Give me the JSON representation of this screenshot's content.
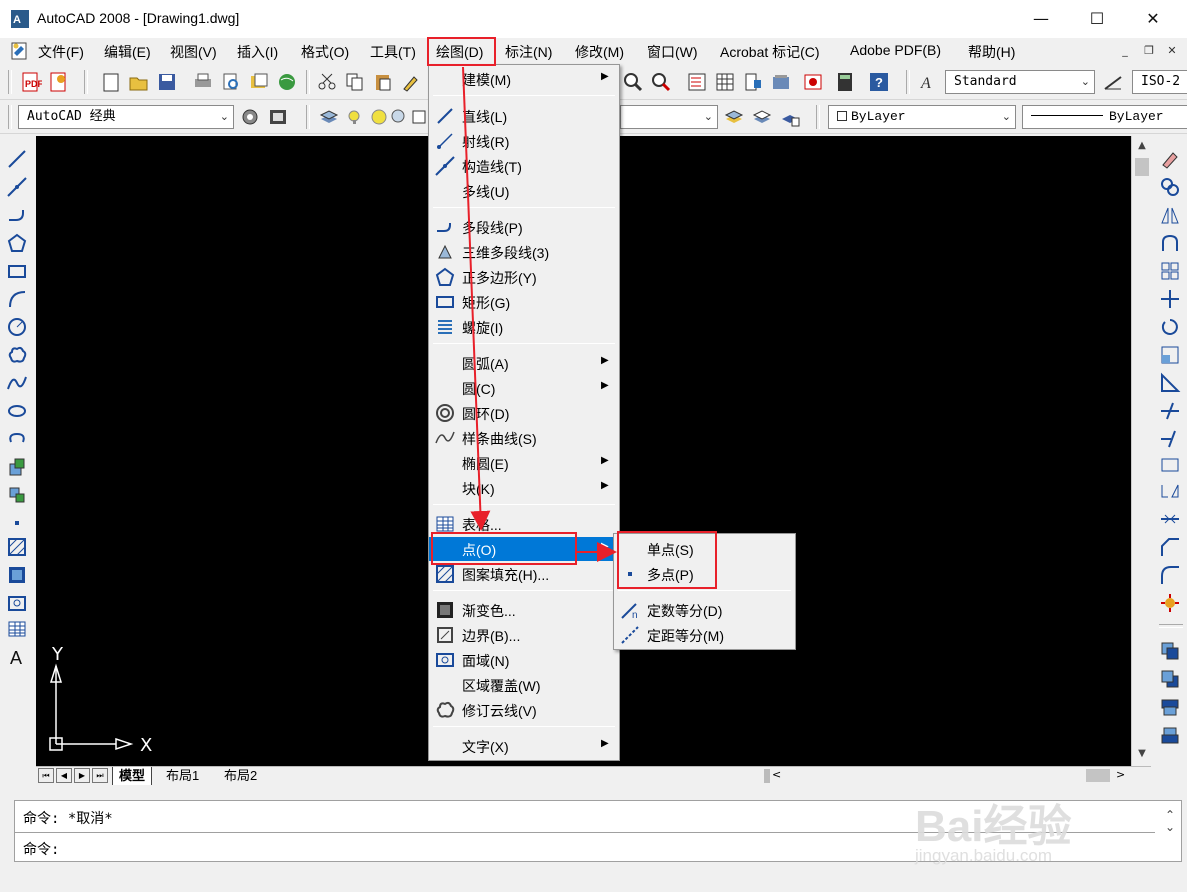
{
  "window": {
    "title": "AutoCAD 2008 - [Drawing1.dwg]",
    "minimize": "—",
    "maximize": "☐",
    "close": "✕"
  },
  "menubar": {
    "items": [
      "文件(F)",
      "编辑(E)",
      "视图(V)",
      "插入(I)",
      "格式(O)",
      "工具(T)",
      "绘图(D)",
      "标注(N)",
      "修改(M)",
      "窗口(W)",
      "Acrobat 标记(C)",
      "Adobe PDF(B)",
      "帮助(H)"
    ],
    "active": "绘图(D)"
  },
  "toolbar": {
    "text_style": "Standard",
    "dim_style": "ISO-2",
    "workspace": "AutoCAD 经典",
    "color": "ByLayer",
    "linetype": "ByLayer"
  },
  "draw_menu": {
    "items": [
      {
        "label": "建模(M)",
        "icon": "none",
        "submenu": true
      },
      {
        "label": "直线(L)",
        "icon": "line-icon"
      },
      {
        "label": "射线(R)",
        "icon": "ray-icon"
      },
      {
        "label": "构造线(T)",
        "icon": "xline-icon"
      },
      {
        "label": "多线(U)",
        "icon": "none"
      },
      {
        "label": "多段线(P)",
        "icon": "polyline-icon"
      },
      {
        "label": "三维多段线(3)",
        "icon": "3dpoly-icon"
      },
      {
        "label": "正多边形(Y)",
        "icon": "polygon-icon"
      },
      {
        "label": "矩形(G)",
        "icon": "rectangle-icon"
      },
      {
        "label": "螺旋(I)",
        "icon": "helix-icon"
      },
      {
        "label": "圆弧(A)",
        "icon": "none",
        "submenu": true
      },
      {
        "label": "圆(C)",
        "icon": "none",
        "submenu": true
      },
      {
        "label": "圆环(D)",
        "icon": "donut-icon"
      },
      {
        "label": "样条曲线(S)",
        "icon": "spline-icon"
      },
      {
        "label": "椭圆(E)",
        "icon": "none",
        "submenu": true
      },
      {
        "label": "块(K)",
        "icon": "none",
        "submenu": true
      },
      {
        "label": "表格...",
        "icon": "table-icon"
      },
      {
        "label": "点(O)",
        "icon": "none",
        "submenu": true,
        "highlighted": true
      },
      {
        "label": "图案填充(H)...",
        "icon": "hatch-icon"
      },
      {
        "label": "渐变色...",
        "icon": "gradient-icon"
      },
      {
        "label": "边界(B)...",
        "icon": "boundary-icon"
      },
      {
        "label": "面域(N)",
        "icon": "region-icon"
      },
      {
        "label": "区域覆盖(W)",
        "icon": "none"
      },
      {
        "label": "修订云线(V)",
        "icon": "revcloud-icon"
      },
      {
        "label": "文字(X)",
        "icon": "none",
        "submenu": true
      }
    ]
  },
  "point_submenu": {
    "items": [
      {
        "label": "单点(S)",
        "icon": "none"
      },
      {
        "label": "多点(P)",
        "icon": "point-icon"
      },
      {
        "label": "定数等分(D)",
        "icon": "divide-icon"
      },
      {
        "label": "定距等分(M)",
        "icon": "measure-icon"
      }
    ]
  },
  "layout_tabs": [
    "模型",
    "布局1",
    "布局2"
  ],
  "command": {
    "line1": "命令: *取消*",
    "line2": "命令:"
  },
  "ucs": {
    "x_label": "X",
    "y_label": "Y"
  },
  "watermark": {
    "big": "Bai经验",
    "small": "jingyan.baidu.com"
  },
  "colors": {
    "highlight": "#0078d7",
    "annotation": "#e8202a",
    "canvas": "#000000"
  }
}
